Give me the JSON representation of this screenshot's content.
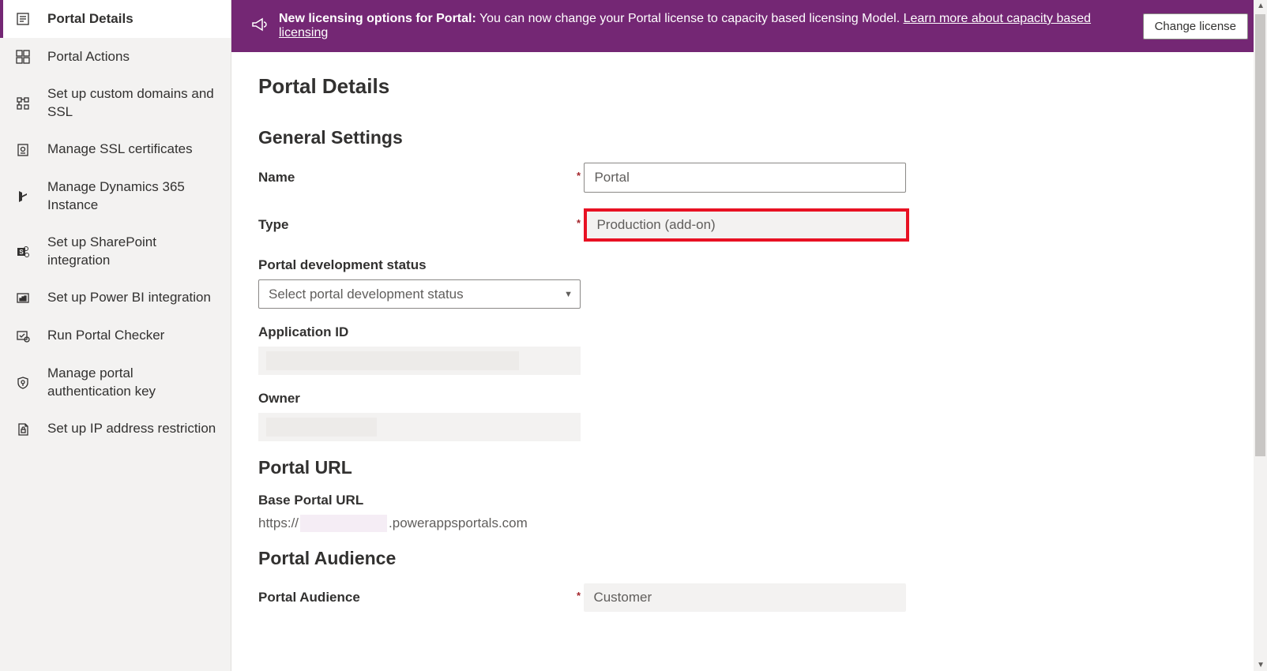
{
  "banner": {
    "title": "New licensing options for Portal:",
    "text": "You can now change your Portal license to capacity based licensing Model.",
    "linkText": "Learn more about capacity based licensing",
    "buttonLabel": "Change license"
  },
  "sidebar": {
    "items": [
      {
        "label": "Portal Details",
        "icon": "details"
      },
      {
        "label": "Portal Actions",
        "icon": "actions"
      },
      {
        "label": "Set up custom domains and SSL",
        "icon": "domains"
      },
      {
        "label": "Manage SSL certificates",
        "icon": "certificates"
      },
      {
        "label": "Manage Dynamics 365 Instance",
        "icon": "dynamics"
      },
      {
        "label": "Set up SharePoint integration",
        "icon": "sharepoint"
      },
      {
        "label": "Set up Power BI integration",
        "icon": "powerbi"
      },
      {
        "label": "Run Portal Checker",
        "icon": "checker"
      },
      {
        "label": "Manage portal authentication key",
        "icon": "authkey"
      },
      {
        "label": "Set up IP address restriction",
        "icon": "iprestrict"
      }
    ]
  },
  "page": {
    "title": "Portal Details",
    "sectionGeneral": "General Settings",
    "sectionPortalUrl": "Portal URL",
    "sectionPortalAudience": "Portal Audience",
    "fields": {
      "name": {
        "label": "Name",
        "value": "Portal"
      },
      "type": {
        "label": "Type",
        "value": "Production (add-on)"
      },
      "devStatus": {
        "label": "Portal development status",
        "value": "Select portal development status"
      },
      "appId": {
        "label": "Application ID"
      },
      "owner": {
        "label": "Owner"
      },
      "baseUrl": {
        "label": "Base Portal URL",
        "prefix": "https://",
        "suffix": ".powerappsportals.com"
      },
      "audience": {
        "label": "Portal Audience",
        "value": "Customer"
      }
    }
  }
}
